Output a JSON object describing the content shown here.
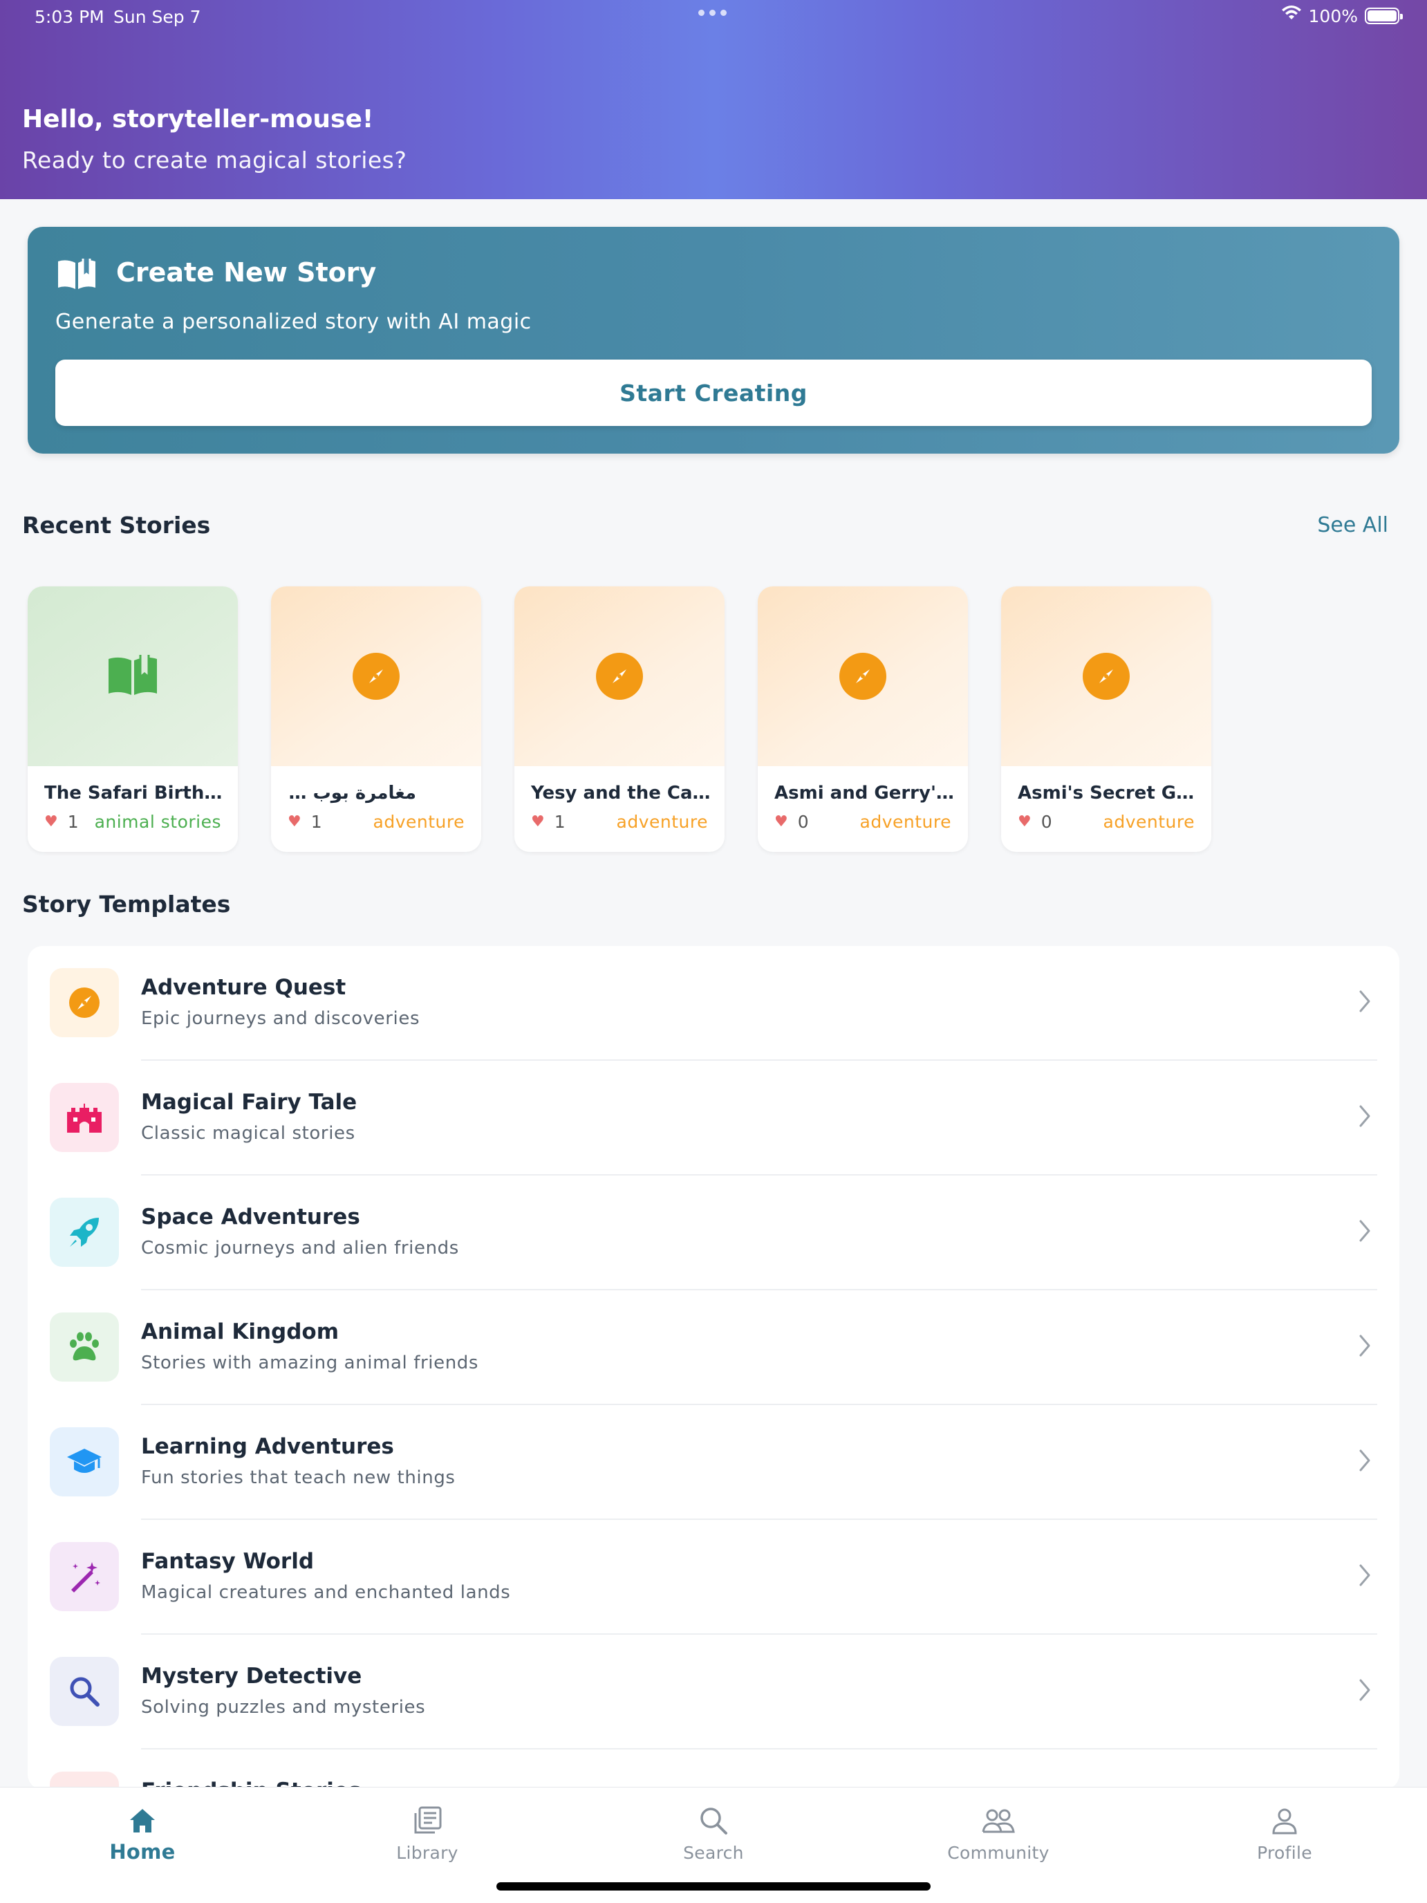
{
  "status_bar": {
    "time": "5:03 PM",
    "date": "Sun Sep 7",
    "battery": "100%"
  },
  "header": {
    "greeting": "Hello, storyteller-mouse!",
    "subtitle": "Ready to create magical stories?"
  },
  "create_card": {
    "title": "Create New Story",
    "subtitle": "Generate a personalized story with AI magic",
    "button_label": "Start Creating",
    "icon": "open-book-icon"
  },
  "recent": {
    "title": "Recent Stories",
    "see_all": "See All",
    "stories": [
      {
        "title": "The Safari Birthday ...",
        "likes": "1",
        "category": "animal stories",
        "icon": "open-book-icon",
        "accent": "#4caf50"
      },
      {
        "title": "مغامرة بوب في الغابة",
        "likes": "1",
        "category": "adventure",
        "icon": "compass-icon",
        "accent": "#f39a14"
      },
      {
        "title": "Yesy and the Cand...",
        "likes": "1",
        "category": "adventure",
        "icon": "compass-icon",
        "accent": "#f39a14"
      },
      {
        "title": "Asmi and Gerry's Ei...",
        "likes": "0",
        "category": "adventure",
        "icon": "compass-icon",
        "accent": "#f39a14"
      },
      {
        "title": "Asmi's Secret Gard...",
        "likes": "0",
        "category": "adventure",
        "icon": "compass-icon",
        "accent": "#f39a14"
      }
    ]
  },
  "templates": {
    "title": "Story Templates",
    "items": [
      {
        "title": "Adventure Quest",
        "description": "Epic journeys and discoveries",
        "icon": "compass-icon",
        "color": "#f39a14",
        "bg": "#fff3e3"
      },
      {
        "title": "Magical Fairy Tale",
        "description": "Classic magical stories",
        "icon": "castle-icon",
        "color": "#e91e63",
        "bg": "#fde7ee"
      },
      {
        "title": "Space Adventures",
        "description": "Cosmic journeys and alien friends",
        "icon": "rocket-icon",
        "color": "#1cb5c8",
        "bg": "#e3f6f9"
      },
      {
        "title": "Animal Kingdom",
        "description": "Stories with amazing animal friends",
        "icon": "paw-icon",
        "color": "#4caf50",
        "bg": "#e9f5ea"
      },
      {
        "title": "Learning Adventures",
        "description": "Fun stories that teach new things",
        "icon": "graduation-cap-icon",
        "color": "#2196f3",
        "bg": "#e5f1fd"
      },
      {
        "title": "Fantasy World",
        "description": "Magical creatures and enchanted lands",
        "icon": "magic-wand-icon",
        "color": "#9c27b0",
        "bg": "#f5e8f8"
      },
      {
        "title": "Mystery Detective",
        "description": "Solving puzzles and mysteries",
        "icon": "search-icon",
        "color": "#3f51b5",
        "bg": "#eceef8"
      },
      {
        "title": "Friendship Stories",
        "description": "",
        "icon": "heart-icon",
        "color": "#e57373",
        "bg": "#fde9e9"
      }
    ]
  },
  "tabbar": {
    "tabs": [
      {
        "label": "Home",
        "icon": "home-icon",
        "active": true
      },
      {
        "label": "Library",
        "icon": "library-icon",
        "active": false
      },
      {
        "label": "Search",
        "icon": "search-icon",
        "active": false
      },
      {
        "label": "Community",
        "icon": "community-icon",
        "active": false
      },
      {
        "label": "Profile",
        "icon": "profile-icon",
        "active": false
      }
    ]
  },
  "colors": {
    "primary": "#2f7a94",
    "header_gradient_start": "#6a43a8",
    "header_gradient_mid": "#6b80e6",
    "orange": "#f39a14",
    "green": "#4caf50"
  }
}
